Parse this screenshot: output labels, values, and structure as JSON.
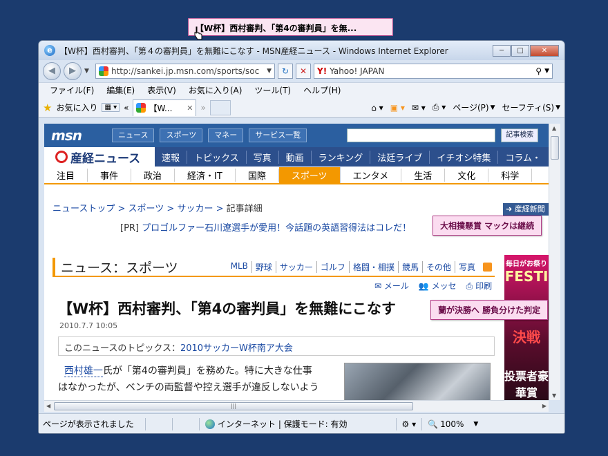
{
  "tooltip": {
    "text": "【W杯】西村審判、「第4の審判員」を無..."
  },
  "window": {
    "title": "【W杯】西村審判、「第４の審判員」を無難にこなす - MSN産経ニュース - Windows Internet Explorer",
    "minimize": "─",
    "maximize": "□",
    "close": "✕"
  },
  "address": {
    "url": "http://sankei.jp.msn.com/sports/soc",
    "refresh": "↻",
    "stop": "✕",
    "search_provider": "Yahoo! JAPAN"
  },
  "menu": [
    "ファイル(F)",
    "編集(E)",
    "表示(V)",
    "お気に入り(A)",
    "ツール(T)",
    "ヘルプ(H)"
  ],
  "commandbar": {
    "favorites": "お気に入り",
    "tab_label": "【W...",
    "page": "ページ(P)",
    "safety": "セーフティ(S)"
  },
  "msn": {
    "logo": "msn",
    "nav": [
      "ニュース",
      "スポーツ",
      "マネー",
      "サービス一覧"
    ],
    "search_button": "記事検索"
  },
  "sankei": {
    "logo": "産経ニュース",
    "links": [
      "速報",
      "トピックス",
      "写真",
      "動画",
      "ランキング",
      "法廷ライブ",
      "イチオシ特集",
      "コラム・"
    ],
    "categories": [
      "注目",
      "事件",
      "政治",
      "経済・IT",
      "国際",
      "スポーツ",
      "エンタメ",
      "生活",
      "文化",
      "科学"
    ]
  },
  "breadcrumb": {
    "items": [
      "ニューストップ",
      "スポーツ",
      "サッカー"
    ],
    "current": "記事詳細"
  },
  "side_button": "産経新聞",
  "pr": {
    "tag": "[PR]",
    "text": "プロゴルファー石川遼選手が愛用！今話題の英語習得法はコレだ！"
  },
  "section": {
    "title": "ニュース：スポーツ",
    "sublinks": [
      "MLB",
      "野球",
      "サッカー",
      "ゴルフ",
      "格闘・相撲",
      "競馬",
      "その他",
      "写真"
    ]
  },
  "tools": [
    "メール",
    "メッセ",
    "印刷"
  ],
  "article": {
    "headline": "【W杯】西村審判、「第4の審判員」を無難にこなす",
    "date": "2010.7.7 10:05",
    "topic_label": "このニュースのトピックス：",
    "topic_link": "2010サッカーW杯南ア大会",
    "body_link": "西村雄一",
    "body_1": "氏が「第4の審判員」を務めた。特に大きな仕事",
    "body_2": "はなかったが、ベンチの両監督や控え選手が違反しないよう"
  },
  "ad": {
    "t1": "毎日がお祭り",
    "t2": "FESTI",
    "t3": "決戦",
    "t4": "投票者豪華賞"
  },
  "popups": {
    "sumo": "大相撲懸賞 マックは継続",
    "netherlands": "蘭が決勝へ 勝負分けた判定"
  },
  "status": {
    "text": "ページが表示されました",
    "zone": "インターネット | 保護モード: 有効",
    "zoom": "100%"
  },
  "colors": {
    "msn_blue": "#2b5fa0",
    "sankei_navy": "#2c4f8c",
    "sports_orange": "#f39800",
    "popup_pink": "#fbdcf0"
  }
}
